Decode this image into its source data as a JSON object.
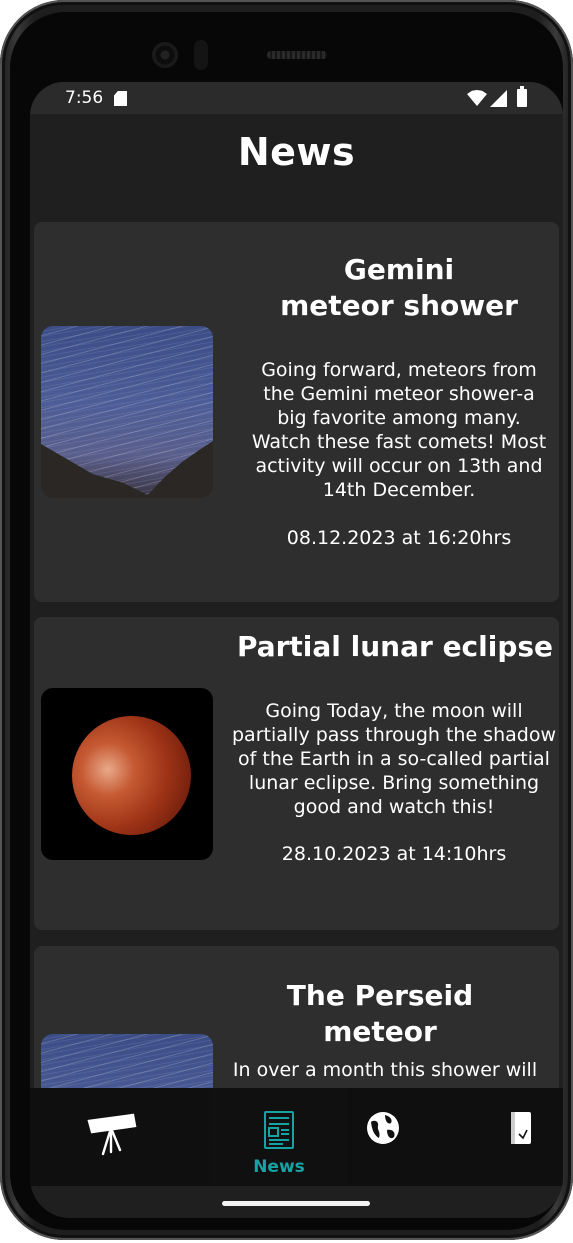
{
  "status_bar": {
    "time": "7:56",
    "icons": [
      "sd-card-icon",
      "wifi-icon",
      "signal-icon",
      "battery-icon"
    ]
  },
  "header": {
    "title": "News"
  },
  "articles": [
    {
      "title": "Gemini\nmeteor shower",
      "body": "Going forward, meteors from the Gemini meteor shower-a big favorite among many. Watch these fast comets! Most activity will occur on 13th and 14th December.",
      "date": "08.12.2023 at 16:20hrs",
      "image": "meteor-shower-image"
    },
    {
      "title": "Partial lunar eclipse",
      "body": "Going Today, the moon will partially pass through the shadow of the Earth in a so-called partial lunar eclipse. Bring something good and watch this!",
      "date": "28.10.2023 at 14:10hrs",
      "image": "lunar-eclipse-image"
    },
    {
      "title": "The Perseid meteor",
      "body": "In over a month this shower will",
      "image": "perseid-meteor-image"
    }
  ],
  "bottom_nav": {
    "items": [
      {
        "id": "telescope",
        "icon": "telescope-icon",
        "label": ""
      },
      {
        "id": "news",
        "icon": "newspaper-icon",
        "label": "News",
        "active": true
      },
      {
        "id": "globe",
        "icon": "globe-icon",
        "label": ""
      },
      {
        "id": "notes",
        "icon": "notebook-icon",
        "label": ""
      }
    ],
    "accent_color": "#17a3a3"
  }
}
